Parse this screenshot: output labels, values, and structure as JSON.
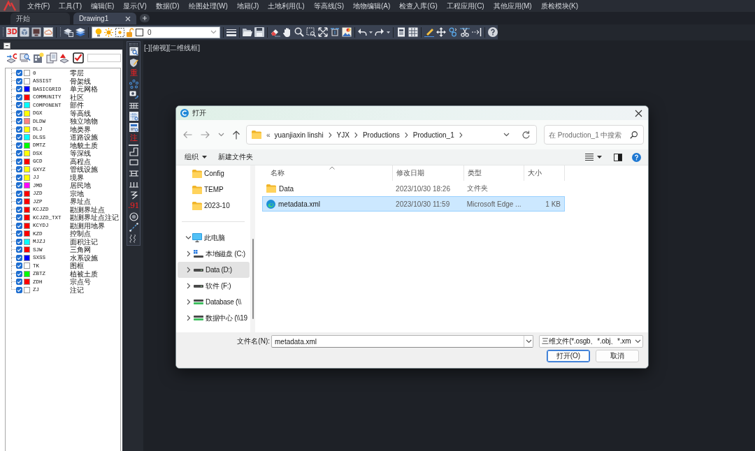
{
  "menu_bar": {
    "items": [
      "文件(F)",
      "工具(T)",
      "编辑(E)",
      "显示(V)",
      "数据(D)",
      "绘图处理(W)",
      "地籍(J)",
      "土地利用(L)",
      "等高线(S)",
      "地物编辑(A)",
      "检查入库(G)",
      "工程应用(C)",
      "其他应用(M)",
      "质检模块(K)"
    ]
  },
  "tabs": [
    {
      "label": "开始",
      "selected": false
    },
    {
      "label": "Drawing1",
      "selected": true
    }
  ],
  "toolbar": {
    "tool_3d": "3D",
    "layer": "0"
  },
  "layer_panel": {
    "layers": [
      {
        "name": "0",
        "color": "#ffffff",
        "description": "零层",
        "checked": true
      },
      {
        "name": "ASSIST",
        "color": "#ffffff",
        "description": "骨架线",
        "checked": true
      },
      {
        "name": "BASICGRID",
        "color": "#0000ff",
        "description": "单元网格",
        "checked": true
      },
      {
        "name": "COMMUNITY",
        "color": "#ff0000",
        "description": "社区",
        "checked": true
      },
      {
        "name": "COMPONENT",
        "color": "#00ffff",
        "description": "部件",
        "checked": true
      },
      {
        "name": "DGX",
        "color": "#ffff00",
        "description": "等高线",
        "checked": true
      },
      {
        "name": "DLDW",
        "color": "#ff8080",
        "description": "独立地物",
        "checked": true
      },
      {
        "name": "DLJ",
        "color": "#ffff00",
        "description": "地类界",
        "checked": true
      },
      {
        "name": "DLSS",
        "color": "#00ffff",
        "description": "道路设施",
        "checked": true
      },
      {
        "name": "DMTZ",
        "color": "#00ff00",
        "description": "地貌土质",
        "checked": true
      },
      {
        "name": "DSX",
        "color": "#ffff00",
        "description": "等深线",
        "checked": true
      },
      {
        "name": "GCD",
        "color": "#ff0000",
        "description": "高程点",
        "checked": true
      },
      {
        "name": "GXYZ",
        "color": "#ffff00",
        "description": "管线设施",
        "checked": true
      },
      {
        "name": "JJ",
        "color": "#ffff00",
        "description": "境界",
        "checked": true
      },
      {
        "name": "JMD",
        "color": "#ff00ff",
        "description": "居民地",
        "checked": true
      },
      {
        "name": "JZD",
        "color": "#ff0000",
        "description": "宗地",
        "checked": true
      },
      {
        "name": "JZP",
        "color": "#ff0000",
        "description": "界址点",
        "checked": true
      },
      {
        "name": "KCJZD",
        "color": "#ff0000",
        "description": "勘测界址点",
        "checked": true
      },
      {
        "name": "KCJZD_TXT",
        "color": "#ff0000",
        "description": "勘测界址点注记",
        "checked": true
      },
      {
        "name": "KCYDJ",
        "color": "#ff0000",
        "description": "勘测用地界",
        "checked": true
      },
      {
        "name": "KZD",
        "color": "#ff0000",
        "description": "控制点",
        "checked": true
      },
      {
        "name": "MJZJ",
        "color": "#00ffff",
        "description": "面积注记",
        "checked": true
      },
      {
        "name": "SJW",
        "color": "#ff0000",
        "description": "三角网",
        "checked": true
      },
      {
        "name": "SXSS",
        "color": "#0000ff",
        "description": "水系设施",
        "checked": true
      },
      {
        "name": "TK",
        "color": "#ffffff",
        "description": "图框",
        "checked": true
      },
      {
        "name": "ZBTZ",
        "color": "#00ff00",
        "description": "植被土质",
        "checked": true
      },
      {
        "name": "ZDH",
        "color": "#ff0000",
        "description": "宗点号",
        "checked": true
      },
      {
        "name": "ZJ",
        "color": "#ffffff",
        "description": "注记",
        "checked": true
      }
    ]
  },
  "side_toolbar": {
    "glyph_tools": [
      "重",
      "注",
      ".91"
    ]
  },
  "viewport": {
    "label": "[-][俯视][二维线框]"
  },
  "dialog": {
    "title": "打开",
    "address": {
      "prefix": "«",
      "crumbs": [
        "yuanjiaxin linshi",
        "YJX",
        "Productions",
        "Production_1"
      ]
    },
    "search": {
      "placeholder": "在 Production_1 中搜索"
    },
    "commands": {
      "organize": "组织",
      "new_folder": "新建文件夹"
    },
    "quick_access": [
      {
        "label": "Config",
        "selected": false
      },
      {
        "label": "TEMP",
        "selected": false
      },
      {
        "label": "2023-10",
        "selected": false
      }
    ],
    "tree": [
      {
        "label": "此电脑",
        "kind": "pc",
        "expanded": true,
        "selected": false,
        "children": [
          {
            "label": "本地磁盘 (C:)",
            "kind": "system-drive",
            "expanded": false,
            "selected": false
          },
          {
            "label": "Data (D:)",
            "kind": "drive",
            "expanded": false,
            "selected": true
          },
          {
            "label": "软件 (F:)",
            "kind": "drive",
            "expanded": false,
            "selected": false
          },
          {
            "label": "Database (\\\\",
            "kind": "network-drive",
            "expanded": false,
            "selected": false
          },
          {
            "label": "数据中心 (\\\\19",
            "kind": "network-drive",
            "expanded": false,
            "selected": false
          }
        ]
      }
    ],
    "columns": [
      {
        "label": "名称",
        "sorted": true
      },
      {
        "label": "修改日期",
        "sorted": false
      },
      {
        "label": "类型",
        "sorted": false
      },
      {
        "label": "大小",
        "sorted": false
      }
    ],
    "files": [
      {
        "kind": "folder",
        "name": "Data",
        "modified": "2023/10/30 18:26",
        "type": "文件夹",
        "selected": false
      },
      {
        "kind": "edge-document",
        "name": "metadata.xml",
        "modified": "2023/10/30 11:59",
        "type": "Microsoft Edge ...",
        "size": "1 KB",
        "selected": true
      }
    ],
    "filename": {
      "label": "文件名(N):",
      "value": "metadata.xml"
    },
    "file_type": {
      "value": "三维文件(*.osgb、*.obj、*.xm"
    },
    "buttons": [
      {
        "label": "打开(O)",
        "default": true
      },
      {
        "label": "取消",
        "default": false
      }
    ]
  }
}
